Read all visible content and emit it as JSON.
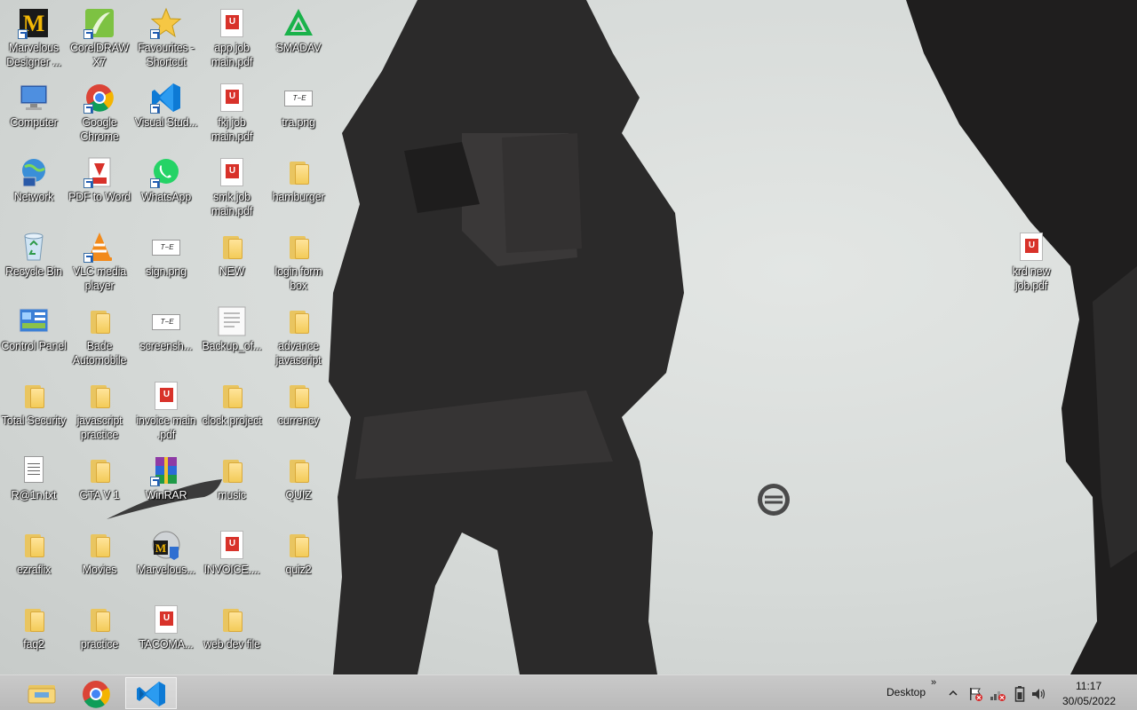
{
  "desktop_icons": [
    {
      "label": "Marvelous Designer ...",
      "icon": "marvelous-designer-icon",
      "shortcut": true
    },
    {
      "label": "CorelDRAW X7",
      "icon": "coreldraw-icon",
      "shortcut": true
    },
    {
      "label": "Favourites - Shortcut",
      "icon": "favourites-star-icon",
      "shortcut": true
    },
    {
      "label": "app job main.pdf",
      "icon": "pdf-file-icon"
    },
    {
      "label": "SMADAV",
      "icon": "smadav-icon"
    },
    {
      "label": "Computer",
      "icon": "computer-icon"
    },
    {
      "label": "Google Chrome",
      "icon": "chrome-icon",
      "shortcut": true
    },
    {
      "label": "Visual Stud...",
      "icon": "vscode-icon",
      "shortcut": true
    },
    {
      "label": "fkj job main.pdf",
      "icon": "pdf-file-icon"
    },
    {
      "label": "tra.png",
      "icon": "image-file-icon"
    },
    {
      "label": "Network",
      "icon": "network-icon"
    },
    {
      "label": "PDF to Word",
      "icon": "pdf-to-word-icon",
      "shortcut": true
    },
    {
      "label": "WhatsApp",
      "icon": "whatsapp-icon",
      "shortcut": true
    },
    {
      "label": "smk job main.pdf",
      "icon": "pdf-file-icon"
    },
    {
      "label": "hamburger",
      "icon": "folder-icon"
    },
    {
      "label": "Recycle Bin",
      "icon": "recycle-bin-icon"
    },
    {
      "label": "VLC media player",
      "icon": "vlc-icon",
      "shortcut": true
    },
    {
      "label": "sign.png",
      "icon": "image-file-icon"
    },
    {
      "label": "NEW",
      "icon": "folder-icon"
    },
    {
      "label": "login form box",
      "icon": "folder-icon"
    },
    {
      "label": "Control Panel",
      "icon": "control-panel-icon"
    },
    {
      "label": "Bade Automobile",
      "icon": "folder-icon"
    },
    {
      "label": "screensh...",
      "icon": "image-file-icon"
    },
    {
      "label": "Backup_of...",
      "icon": "document-file-icon"
    },
    {
      "label": "advance javascript",
      "icon": "folder-icon"
    },
    {
      "label": "Total Security",
      "icon": "folder-icon"
    },
    {
      "label": "javascript practice",
      "icon": "folder-icon"
    },
    {
      "label": "invoice main .pdf",
      "icon": "pdf-file-icon"
    },
    {
      "label": "clock project",
      "icon": "folder-icon"
    },
    {
      "label": "currency",
      "icon": "folder-icon"
    },
    {
      "label": "R@1n.txt",
      "icon": "text-file-icon"
    },
    {
      "label": "GTA V 1",
      "icon": "folder-icon"
    },
    {
      "label": "WinRAR",
      "icon": "winrar-icon",
      "shortcut": true
    },
    {
      "label": "music",
      "icon": "folder-icon"
    },
    {
      "label": "QUIZ",
      "icon": "folder-icon"
    },
    {
      "label": "ezraflix",
      "icon": "folder-icon"
    },
    {
      "label": "Movies",
      "icon": "folder-icon"
    },
    {
      "label": "Marvelous...",
      "icon": "marvelous-installer-icon"
    },
    {
      "label": "INVOICE....",
      "icon": "pdf-file-icon"
    },
    {
      "label": "quiz2",
      "icon": "folder-icon"
    },
    {
      "label": "faq2",
      "icon": "folder-icon"
    },
    {
      "label": "practice",
      "icon": "folder-icon"
    },
    {
      "label": "TACOMA...",
      "icon": "pdf-file-icon"
    },
    {
      "label": "web dev file",
      "icon": "folder-icon"
    },
    {
      "label": "krd new job.pdf",
      "icon": "pdf-file-icon"
    }
  ],
  "taskbar": {
    "pinned_apps": [
      {
        "name": "File Explorer",
        "icon": "file-explorer-icon"
      },
      {
        "name": "Google Chrome",
        "icon": "chrome-icon"
      },
      {
        "name": "Visual Studio Code",
        "icon": "vscode-icon",
        "active": true
      }
    ],
    "desktop_toolbar_label": "Desktop",
    "toolbar_chevron": "»",
    "tray_icons": [
      "show-hidden-icons-arrow-icon",
      "action-center-flag-icon",
      "network-disconnected-icon",
      "battery-icon",
      "volume-icon"
    ],
    "clock_time": "11:17",
    "clock_date": "30/05/2022"
  },
  "colors": {
    "label_text": "#ffffff",
    "taskbar_bg": "#c4c4c4",
    "folder": "#f3cb58",
    "pdf_badge": "#d8322a"
  }
}
